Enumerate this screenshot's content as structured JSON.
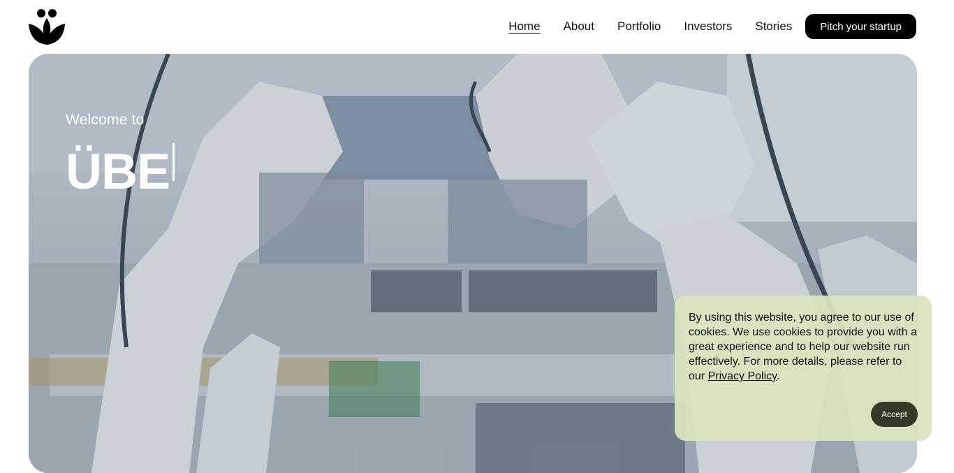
{
  "header": {
    "nav": [
      {
        "label": "Home",
        "active": true
      },
      {
        "label": "About",
        "active": false
      },
      {
        "label": "Portfolio",
        "active": false
      },
      {
        "label": "Investors",
        "active": false
      },
      {
        "label": "Stories",
        "active": false
      }
    ],
    "cta_label": "Pitch your startup",
    "logo_icon": "leaf-figure-logo"
  },
  "hero": {
    "welcome": "Welcome to",
    "brand": "ÜBE",
    "image_subject": "robotic-arm-factory-photo"
  },
  "cookie": {
    "text_before": "By using this website, you agree to our use of cookies. We use cookies to provide you with a great experience and to help our website run effectively. For more details, please refer to our ",
    "link_label": "Privacy Policy",
    "text_after": ".",
    "accept_label": "Accept"
  },
  "colors": {
    "cta_bg": "#000000",
    "cookie_bg": "#dae4be",
    "accept_bg": "#333a28"
  }
}
